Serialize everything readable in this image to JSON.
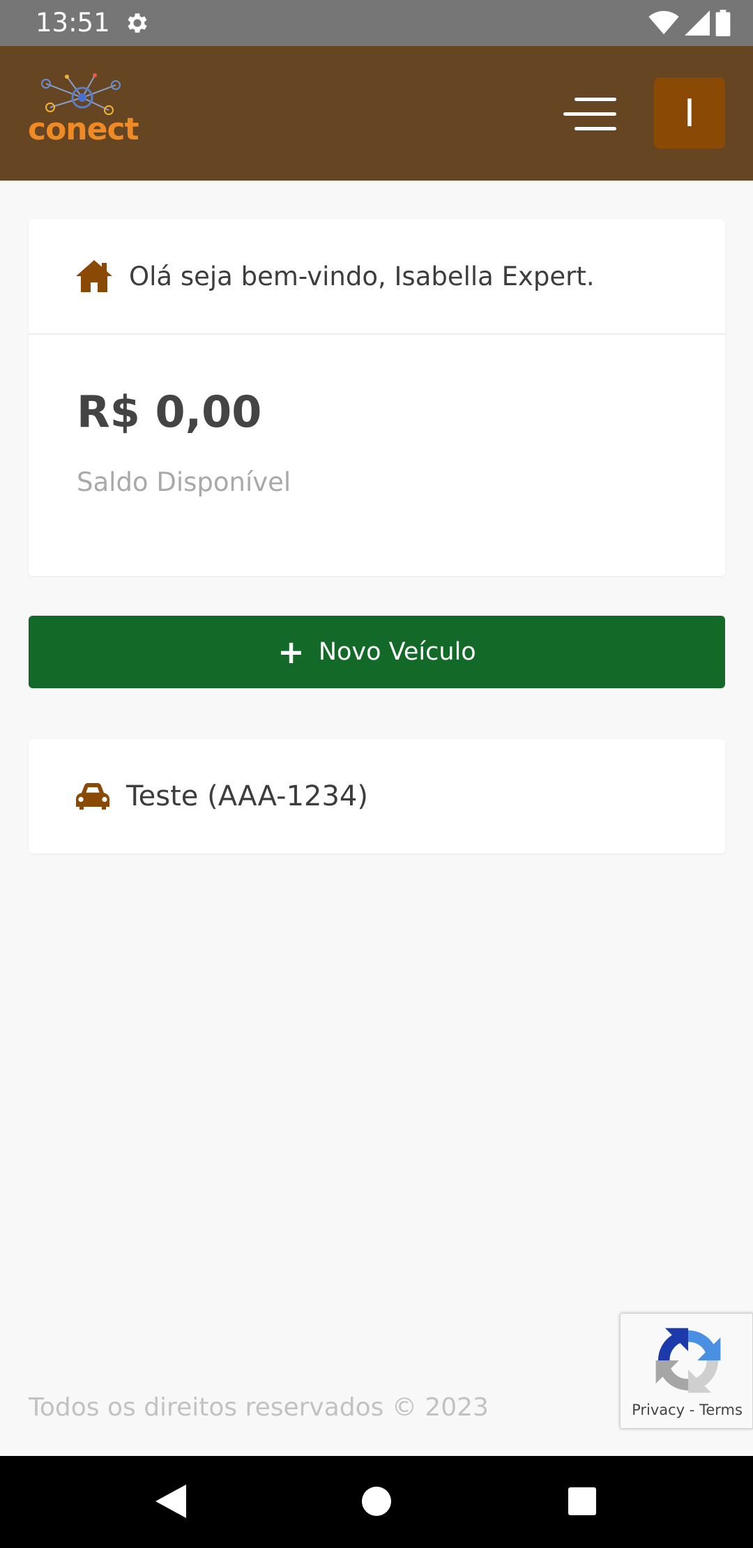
{
  "status_bar": {
    "time": "13:51",
    "icons": [
      "gear-icon",
      "wifi-icon",
      "signal-icon",
      "battery-icon"
    ]
  },
  "header": {
    "logo_text": "conect",
    "avatar_initial": "I",
    "colors": {
      "background": "#654522",
      "avatar": "#8a4a05",
      "logo": "#f08a24"
    }
  },
  "welcome": {
    "icon": "home-icon",
    "greeting": "Olá seja bem-vindo, Isabella Expert.",
    "balance": "R$ 0,00",
    "balance_label": "Saldo Disponível"
  },
  "actions": {
    "new_vehicle_label": "Novo Veículo",
    "color": "#136a28"
  },
  "vehicles": [
    {
      "icon": "car-icon",
      "label": "Teste (AAA-1234)"
    }
  ],
  "footer": {
    "copyright": "Todos os direitos reservados © 2023"
  },
  "recaptcha": {
    "privacy": "Privacy",
    "separator": " - ",
    "terms": "Terms"
  }
}
